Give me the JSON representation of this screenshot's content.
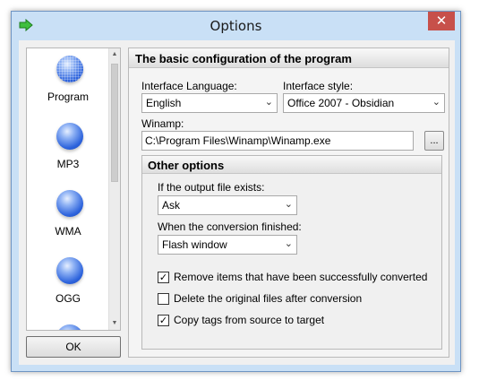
{
  "window": {
    "title": "Options",
    "close_glyph": "✕",
    "icon": "arrow-right-icon"
  },
  "sidebar": {
    "items": [
      {
        "label": "Program",
        "icon": "orb-icon",
        "selected": true
      },
      {
        "label": "MP3",
        "icon": "orb-icon"
      },
      {
        "label": "WMA",
        "icon": "orb-icon"
      },
      {
        "label": "OGG",
        "icon": "orb-icon"
      }
    ],
    "scroll_up": "▲",
    "scroll_down": "▼"
  },
  "ok_button": {
    "label": "OK"
  },
  "main": {
    "header": "The basic configuration of the program",
    "language": {
      "label": "Interface Language:",
      "value": "English"
    },
    "style": {
      "label": "Interface style:",
      "value": "Office 2007 - Obsidian"
    },
    "winamp": {
      "label": "Winamp:",
      "value": "C:\\Program Files\\Winamp\\Winamp.exe",
      "browse": "..."
    },
    "other": {
      "header": "Other options",
      "exists": {
        "label": "If the output file exists:",
        "value": "Ask"
      },
      "finished": {
        "label": "When the conversion finished:",
        "value": "Flash window"
      },
      "checks": [
        {
          "label": "Remove items that have been successfully converted",
          "checked": true
        },
        {
          "label": "Delete the original files after conversion",
          "checked": false
        },
        {
          "label": "Copy tags from source to target",
          "checked": true
        }
      ]
    }
  },
  "dropdown_arrow": "⌄",
  "check_mark": "✓",
  "colors": {
    "title_bar": "#c9e0f6",
    "close": "#c7504a",
    "orb": "#2d63dc"
  }
}
